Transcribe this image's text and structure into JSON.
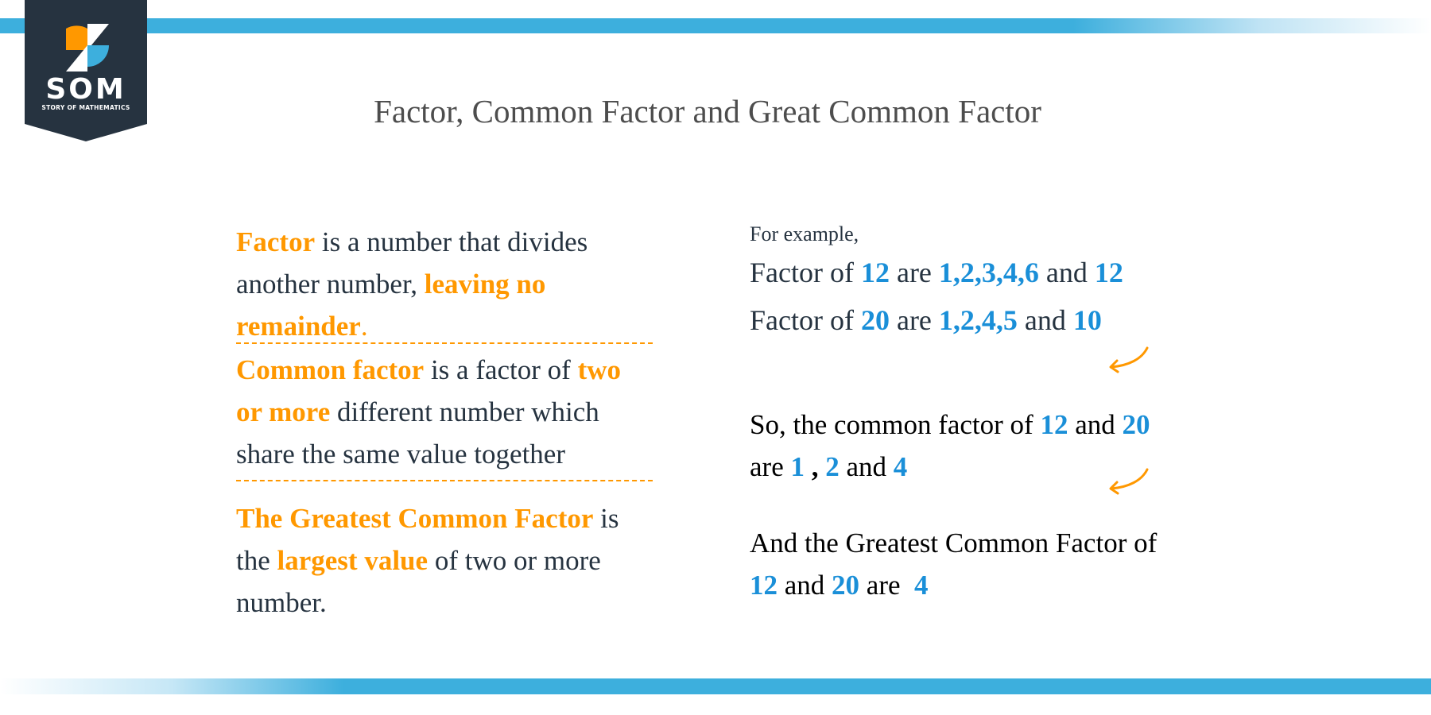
{
  "logo": {
    "brand": "SOM",
    "subtitle": "STORY OF MATHEMATICS",
    "colors": {
      "badge": "#263340",
      "orange": "#ff9800",
      "blue": "#3dafdd"
    }
  },
  "title": "Factor, Common Factor and Great Common Factor",
  "colors": {
    "accent_orange": "#ff9800",
    "accent_blue": "#1a8fd8",
    "bar_blue": "#3dafdd",
    "body_text": "#263340",
    "title_text": "#4d4d4d"
  },
  "definitions": {
    "factor": {
      "term": "Factor",
      "text1": " is a number that divides another number, ",
      "highlight": "leaving no remainder",
      "text2": "."
    },
    "common_factor": {
      "term": "Common factor",
      "text1": " is a factor of ",
      "highlight": "two or more",
      "text2": " different number which share the same value together"
    },
    "gcf": {
      "term": "The Greatest Common Factor",
      "text1": " is the ",
      "highlight": "largest value",
      "text2": " of two or more number."
    }
  },
  "example": {
    "intro": "For example,",
    "line1": {
      "prefix": "Factor of ",
      "number": "12",
      "mid": " are ",
      "factors": "1,2,3,4,6",
      "and": " and ",
      "last": "12"
    },
    "line2": {
      "prefix": "Factor of ",
      "number": "20",
      "mid": " are ",
      "factors": "1,2,4,5",
      "and": " and ",
      "last": "10"
    },
    "common": {
      "prefix": "So, the common factor of ",
      "a": "12",
      "and1": " and ",
      "b": "20",
      "are": "are ",
      "f1": "1",
      "comma": " , ",
      "f2": "2",
      "and2": " and ",
      "f3": "4"
    },
    "gcf": {
      "prefix": "And the Greatest Common Factor of",
      "a": "12",
      "and": " and ",
      "b": "20",
      "are": " are  ",
      "result": "4"
    }
  }
}
